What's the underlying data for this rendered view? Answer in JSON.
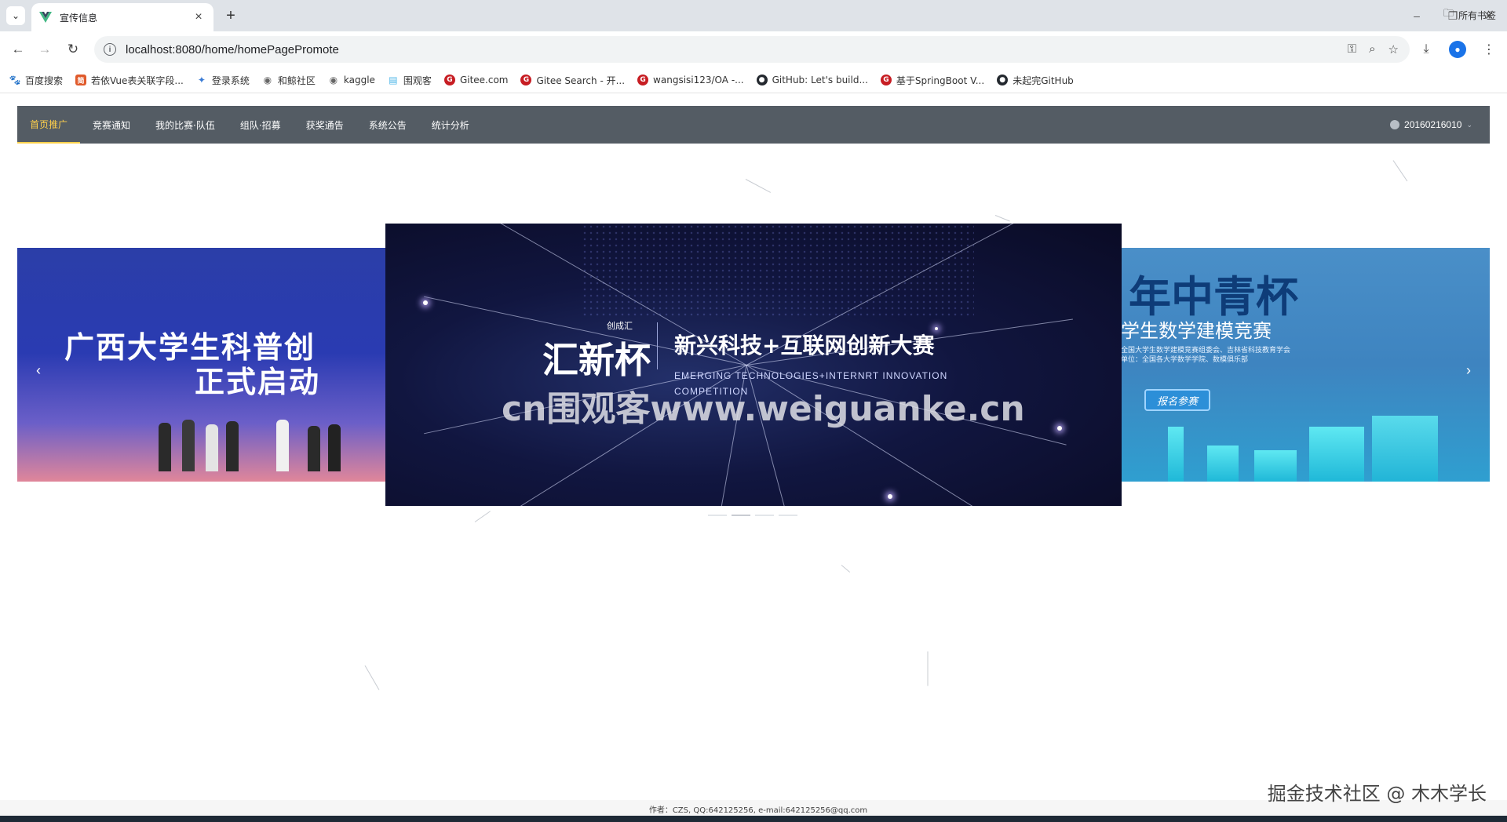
{
  "browser": {
    "tab_title": "宣传信息",
    "url": "localhost:8080/home/homePagePromote",
    "all_bookmarks_label": "所有书签",
    "bookmarks": [
      {
        "label": "百度搜索",
        "icon": "paw-icon",
        "color": "#2932e1"
      },
      {
        "label": "若依Vue表关联字段...",
        "icon": "jian-icon",
        "color": "#e05a2b"
      },
      {
        "label": "登录系统",
        "icon": "bird-icon",
        "color": "#3a7bd5"
      },
      {
        "label": "和鲸社区",
        "icon": "globe-icon",
        "color": "#666666"
      },
      {
        "label": "kaggle",
        "icon": "globe-icon",
        "color": "#666666"
      },
      {
        "label": "围观客",
        "icon": "doc-icon",
        "color": "#4db6e8"
      },
      {
        "label": "Gitee.com",
        "icon": "gitee-icon",
        "color": "#c71d23"
      },
      {
        "label": "Gitee Search - 开...",
        "icon": "gitee-icon",
        "color": "#c71d23"
      },
      {
        "label": "wangsisi123/OA -...",
        "icon": "gitee-icon",
        "color": "#c71d23"
      },
      {
        "label": "GitHub: Let's build...",
        "icon": "github-icon",
        "color": "#24292f"
      },
      {
        "label": "基于SpringBoot V...",
        "icon": "gitee-icon",
        "color": "#c71d23"
      },
      {
        "label": "未起完GitHub",
        "icon": "github-icon",
        "color": "#24292f"
      }
    ]
  },
  "navbar": {
    "items": [
      {
        "label": "首页推广",
        "active": true
      },
      {
        "label": "竞赛通知",
        "active": false
      },
      {
        "label": "我的比赛·队伍",
        "active": false
      },
      {
        "label": "组队·招募",
        "active": false
      },
      {
        "label": "获奖通告",
        "active": false
      },
      {
        "label": "系统公告",
        "active": false
      },
      {
        "label": "统计分析",
        "active": false
      }
    ],
    "user": "20160216010",
    "colors": {
      "bg": "#545c64",
      "active": "#ffd04b",
      "text": "#ffffff"
    }
  },
  "carousel": {
    "left_card": {
      "line1": "广西大学生科普创",
      "line2": "正式启动"
    },
    "center_card": {
      "logo": "汇新杯",
      "brand": "创成汇",
      "title": "新兴科技+互联网创新大赛",
      "en_line1": "EMERGING  TECHNOLOGIES+INTERNRT  INNOVATION",
      "en_line2": "COMPETITION",
      "watermark": "cn围观客www.weiguanke.cn"
    },
    "right_card": {
      "title": "年中青杯",
      "subtitle": "学生数学建模竞赛",
      "small_line1": "全国大学生数学建模竞赛组委会、吉林省科技教育学会",
      "small_line2": "单位：全国各大学数学学院、数模俱乐部",
      "button": "报名参赛"
    },
    "prev_icon": "‹",
    "next_icon": "›",
    "indicator_count": 4,
    "active_index": 1
  },
  "footer": {
    "author": "作者：CZS, QQ:642125256, e-mail:642125256@qq.com",
    "watermark": "掘金技术社区 @ 木木学长"
  }
}
